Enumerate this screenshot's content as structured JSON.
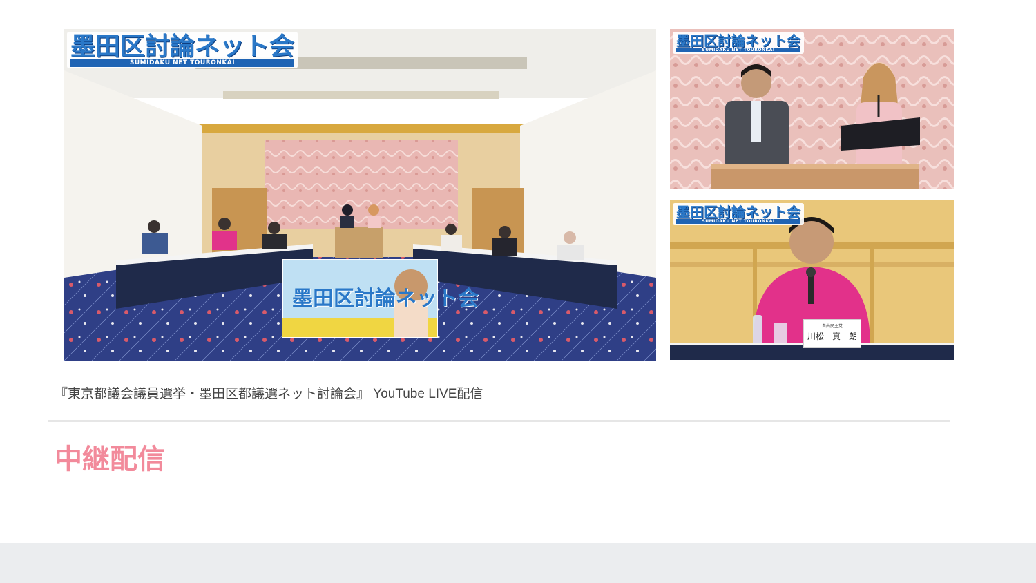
{
  "gallery": {
    "logo": {
      "title": "墨田区討論ネット会",
      "subtitle": "SUMIDAKU NET TOURONKAI"
    },
    "main_photo": {
      "banner_text": "墨田区討論ネット会"
    },
    "side_bottom": {
      "nameplate_party": "自由民主党",
      "nameplate_name": "川松　真一朗"
    }
  },
  "caption": "『東京都議会議員選挙・墨田区都議選ネット討論会』 YouTube LIVE配信",
  "section": {
    "title": "中継配信"
  },
  "colors": {
    "accent_pink": "#f28a9b",
    "caption_text": "#444444",
    "divider": "#e6e6e6",
    "footer_band": "#ebedef",
    "logo_blue": "#2a78c8"
  }
}
